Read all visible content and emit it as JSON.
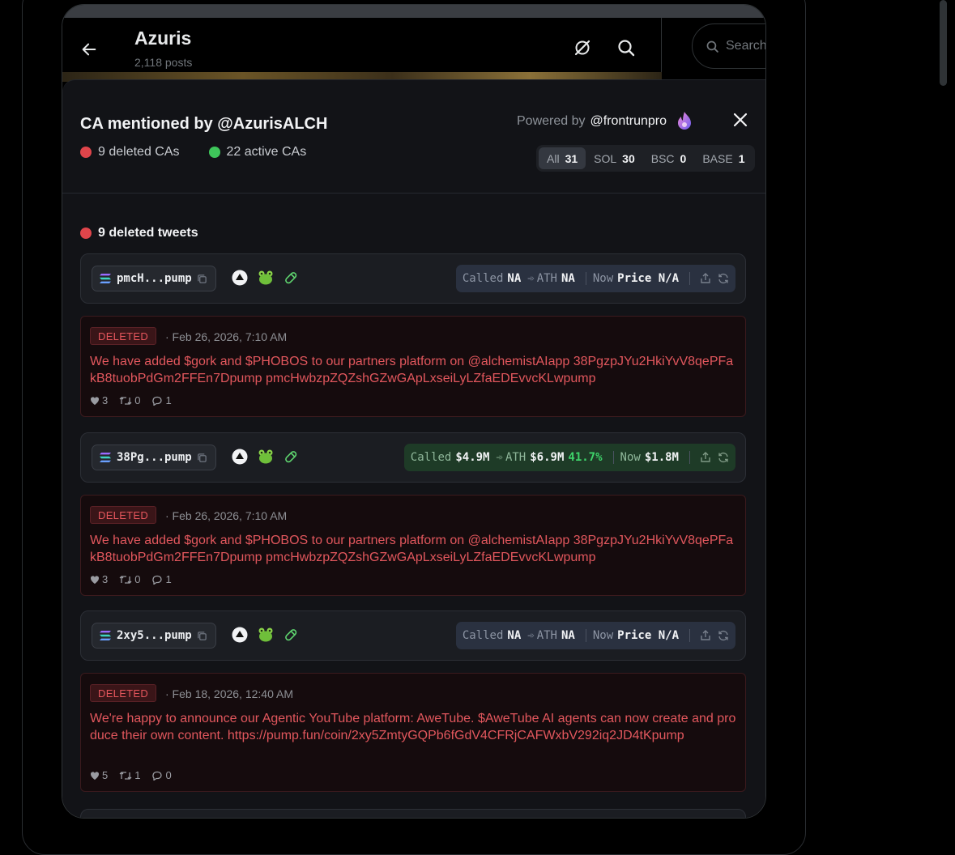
{
  "profile": {
    "name": "Azuris",
    "posts": "2,118 posts"
  },
  "search": {
    "placeholder": "Search"
  },
  "panel": {
    "title": "CA mentioned by @AzurisALCH",
    "deleted_count": "9 deleted CAs",
    "active_count": "22 active CAs",
    "powered_label": "Powered by",
    "powered_handle": "@frontrunpro"
  },
  "chains": [
    {
      "label": "All",
      "count": "31",
      "active": true
    },
    {
      "label": "SOL",
      "count": "30",
      "active": false
    },
    {
      "label": "BSC",
      "count": "0",
      "active": false
    },
    {
      "label": "BASE",
      "count": "1",
      "active": false
    }
  ],
  "section": {
    "title": "9 deleted tweets"
  },
  "items": [
    {
      "ca": "pmcH...pump",
      "stats": {
        "called_label": "Called",
        "called": "NA",
        "ath_label": "ATH",
        "ath": "NA",
        "pct": "",
        "now_label": "Now",
        "now": "Price N/A",
        "style": "gray"
      },
      "tweet": {
        "badge": "DELETED",
        "date": "· Feb 26, 2026, 7:10 AM",
        "text": "We have added $gork and $PHOBOS to our partners platform on @alchemistAIapp 38PgzpJYu2HkiYvV8qePFakB8tuobPdGm2FFEn7Dpump pmcHwbzpZQZshGZwGApLxseiLyLZfaEDEvvcKLwpump",
        "likes": "3",
        "retweets": "0",
        "replies": "1"
      }
    },
    {
      "ca": "38Pg...pump",
      "stats": {
        "called_label": "Called",
        "called": "$4.9M",
        "ath_label": "ATH",
        "ath": "$6.9M",
        "pct": "41.7%",
        "now_label": "Now",
        "now": "$1.8M",
        "style": "green"
      },
      "tweet": {
        "badge": "DELETED",
        "date": "· Feb 26, 2026, 7:10 AM",
        "text": "We have added $gork and $PHOBOS to our partners platform on @alchemistAIapp 38PgzpJYu2HkiYvV8qePFakB8tuobPdGm2FFEn7Dpump pmcHwbzpZQZshGZwGApLxseiLyLZfaEDEvvcKLwpump",
        "likes": "3",
        "retweets": "0",
        "replies": "1"
      }
    },
    {
      "ca": "2xy5...pump",
      "stats": {
        "called_label": "Called",
        "called": "NA",
        "ath_label": "ATH",
        "ath": "NA",
        "pct": "",
        "now_label": "Now",
        "now": "Price N/A",
        "style": "gray"
      },
      "tweet": {
        "badge": "DELETED",
        "date": "· Feb 18, 2026, 12:40 AM",
        "text": "We're happy to announce our Agentic YouTube platform: AweTube. $AweTube AI agents can now create and produce their own content. https://pump.fun/coin/2xy5ZmtyGQPb6fGdV4CFRjCAFWxbV292iq2JD4tKpump",
        "likes": "5",
        "retweets": "1",
        "replies": "0"
      }
    }
  ],
  "colors": {
    "deleted": "#e0454b",
    "active": "#3ec65a",
    "gain": "#3ed36a",
    "panel_bg": "#121317"
  }
}
